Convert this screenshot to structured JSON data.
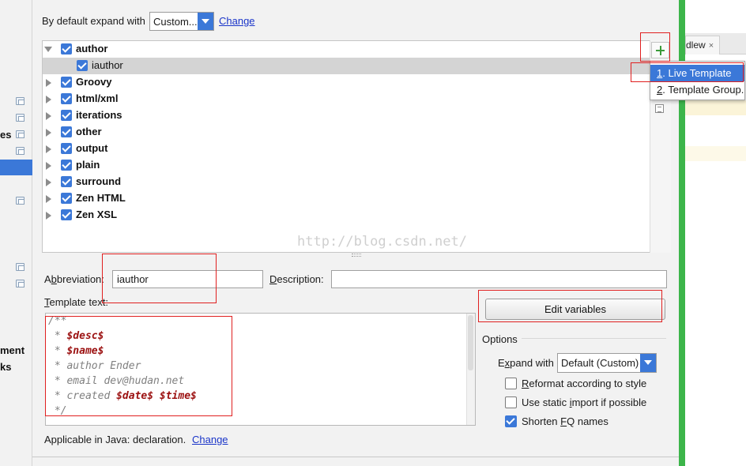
{
  "sidebar": {
    "partial_texts": [
      "es",
      "ment",
      "ks"
    ]
  },
  "header": {
    "expand_label": "By default expand with",
    "expand_value": "Custom...",
    "change_label": "Change"
  },
  "tree": {
    "groups": [
      {
        "name": "author",
        "expanded": true,
        "checked": true
      },
      {
        "name": "iauthor",
        "child": true,
        "checked": true,
        "selected": true
      },
      {
        "name": "Groovy",
        "checked": true
      },
      {
        "name": "html/xml",
        "checked": true
      },
      {
        "name": "iterations",
        "checked": true
      },
      {
        "name": "other",
        "checked": true
      },
      {
        "name": "output",
        "checked": true
      },
      {
        "name": "plain",
        "checked": true
      },
      {
        "name": "surround",
        "checked": true
      },
      {
        "name": "Zen HTML",
        "checked": true
      },
      {
        "name": "Zen XSL",
        "checked": true
      }
    ]
  },
  "toolbar": {
    "add_icon": "plus-icon",
    "doc_icon": "document-icon"
  },
  "popup_menu": {
    "items": [
      {
        "mnemonic": "1",
        "label": ". Live Template",
        "active": true
      },
      {
        "mnemonic": "2",
        "label": ". Template Group...",
        "active": false
      }
    ]
  },
  "background_window": {
    "tab_label": "dlew",
    "tab_close": "×"
  },
  "watermark": "http://blog.csdn.net/",
  "fields": {
    "abbreviation_label_pre": "A",
    "abbreviation_label_mn": "b",
    "abbreviation_label_post": "breviation:",
    "abbreviation_value": "iauthor",
    "description_label_mn": "D",
    "description_label_post": "escription:",
    "description_value": "",
    "template_text_label_mn": "T",
    "template_text_label_post": "emplate text:"
  },
  "template_text": {
    "lines": [
      {
        "prefix": "/**",
        "var": "",
        "rest": ""
      },
      {
        "prefix": " * ",
        "var": "$desc$",
        "rest": ""
      },
      {
        "prefix": " * ",
        "var": "$name$",
        "rest": ""
      },
      {
        "prefix": " * author Ender",
        "var": "",
        "rest": ""
      },
      {
        "prefix": " * email dev@hudan.net",
        "var": "",
        "rest": ""
      },
      {
        "prefix": " * created ",
        "var": "$date$",
        "rest": "",
        "var2": "$time$"
      },
      {
        "prefix": " */",
        "var": "",
        "rest": ""
      }
    ]
  },
  "edit_variables_label": "Edit variables",
  "options": {
    "title": "Options",
    "expand_with_label_pre": "E",
    "expand_with_label_mn": "x",
    "expand_with_label_post": "pand with",
    "expand_with_value": "Default (Custom)",
    "reformat": {
      "pre": "",
      "mn": "R",
      "post": "eformat according to style",
      "checked": false
    },
    "static_import": {
      "pre": "Use static ",
      "mn": "i",
      "post": "mport if possible",
      "checked": false
    },
    "shorten_fq": {
      "pre": "Shorten ",
      "mn": "F",
      "post": "Q names",
      "checked": true
    }
  },
  "applicable": {
    "text": "Applicable in Java: declaration.",
    "change_label": "Change"
  },
  "colors": {
    "accent": "#3b78d8",
    "annotation_red": "#e02020",
    "green_bar": "#3cb54a"
  }
}
